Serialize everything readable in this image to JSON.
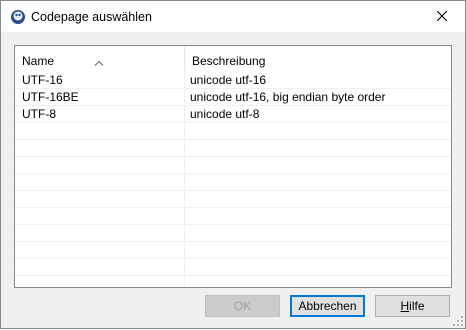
{
  "window": {
    "title": "Codepage auswählen",
    "app_icon": "app-icon",
    "close_icon": "close-icon"
  },
  "list": {
    "columns": [
      "Name",
      "Beschreibung"
    ],
    "sort_column": "Name",
    "sort_direction": "ascending",
    "rows": [
      {
        "name": "UTF-16",
        "description": "unicode utf-16"
      },
      {
        "name": "UTF-16BE",
        "description": "unicode utf-16, big endian byte order"
      },
      {
        "name": "UTF-8",
        "description": "unicode utf-8"
      },
      {
        "name": "",
        "description": ""
      },
      {
        "name": "",
        "description": ""
      },
      {
        "name": "",
        "description": ""
      },
      {
        "name": "",
        "description": ""
      },
      {
        "name": "",
        "description": ""
      },
      {
        "name": "",
        "description": ""
      },
      {
        "name": "",
        "description": ""
      },
      {
        "name": "",
        "description": ""
      },
      {
        "name": "",
        "description": ""
      },
      {
        "name": "",
        "description": ""
      }
    ]
  },
  "buttons": {
    "ok": "OK",
    "cancel": "Abbrechen",
    "help_first": "H",
    "help_rest": "ilfe"
  },
  "colors": {
    "focus_border": "#0078d7",
    "dialog_bg": "#f0f0f0"
  }
}
